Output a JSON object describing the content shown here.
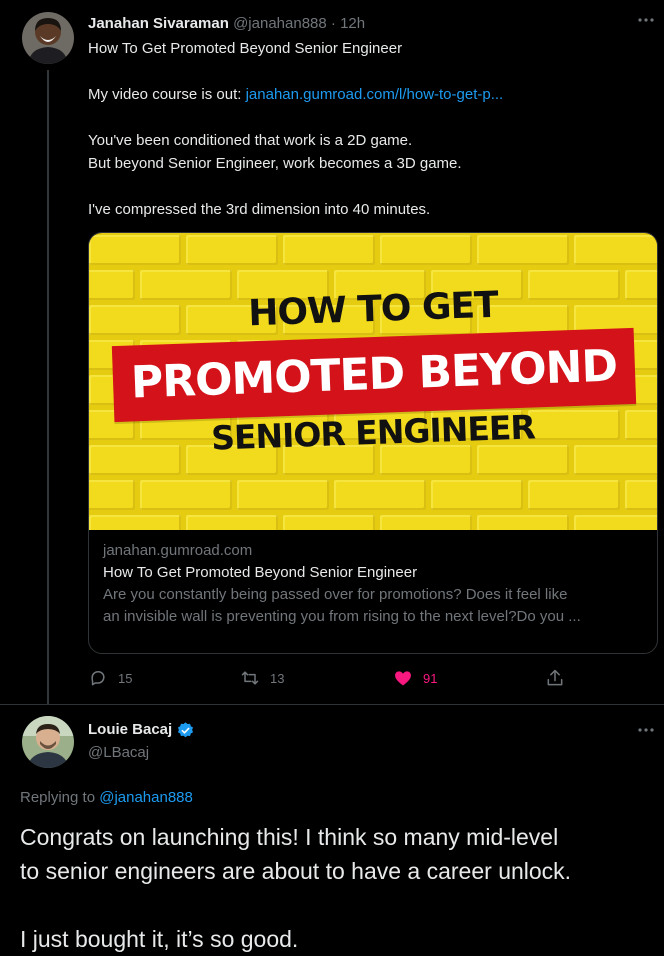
{
  "tweet": {
    "author_name": "Janahan Sivaraman",
    "handle": "@janahan888",
    "separator": "·",
    "time": "12h",
    "title_line": "How To Get Promoted Beyond Senior Engineer",
    "course_prefix": "My video course is out: ",
    "course_link": "janahan.gumroad.com/l/how-to-get-p...",
    "line3": "You've been conditioned that work is a 2D game.",
    "line4": "But beyond Senior Engineer, work becomes a 3D game.",
    "line5": "I've compressed the 3rd dimension into 40 minutes.",
    "more_icon": "ellipsis-icon"
  },
  "card": {
    "image_text": {
      "top": "HOW TO GET",
      "middle": "PROMOTED BEYOND",
      "bottom": "SENIOR ENGINEER"
    },
    "domain": "janahan.gumroad.com",
    "title": "How To Get Promoted Beyond Senior Engineer",
    "desc_line1": "Are you constantly being passed over for promotions? Does it feel like",
    "desc_line2": "an invisible wall is preventing you from rising to the next level?Do you ..."
  },
  "actions": {
    "replies": "15",
    "retweets": "13",
    "likes": "91",
    "colors": {
      "like": "#f91880",
      "muted": "#71767b"
    }
  },
  "reply": {
    "author_name": "Louie Bacaj",
    "handle": "@LBacaj",
    "replying_prefix": "Replying to ",
    "replying_handle": "@janahan888",
    "text_line1": "Congrats on launching this! I think so many mid-level",
    "text_line2": "to senior engineers are about to have a career unlock.",
    "text_line3": "I just bought it, it’s so good.",
    "verified_color": "#1d9bf0"
  },
  "colors": {
    "background": "#000000",
    "text": "#e7e9ea",
    "muted": "#71767b",
    "link": "#1d9bf0",
    "card_yellow": "#f2db1c",
    "banner_red": "#d4121a"
  }
}
